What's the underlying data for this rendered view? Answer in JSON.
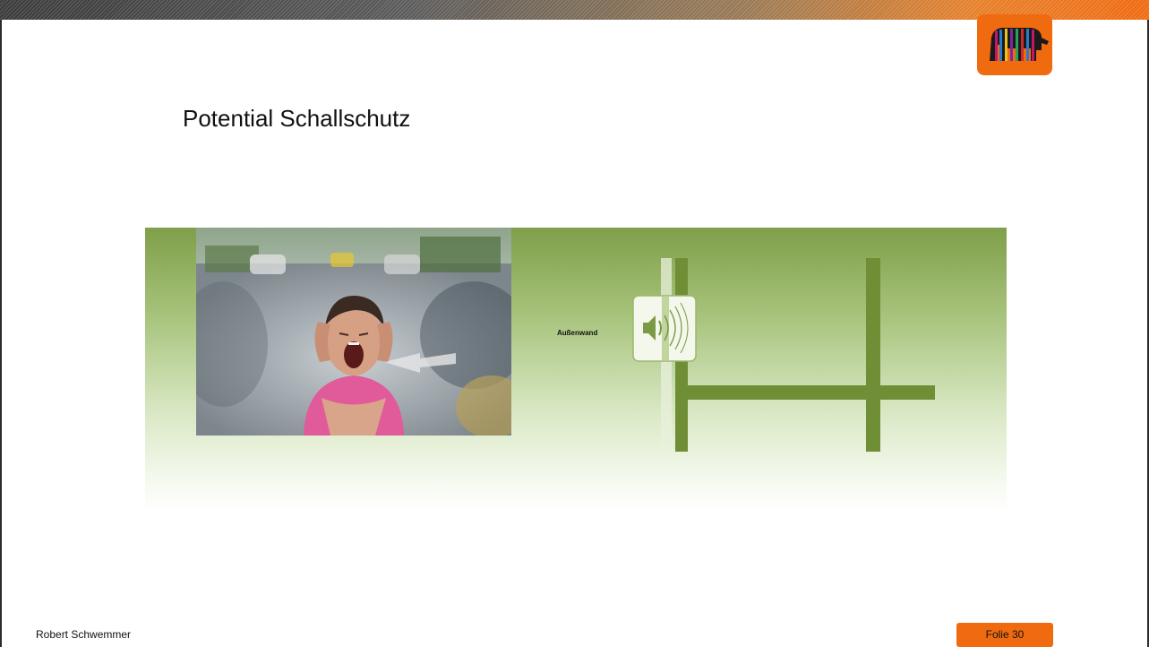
{
  "slide": {
    "title": "Potential Schallschutz",
    "wall_label": "Außenwand",
    "footer_author": "Robert Schwemmer",
    "slide_number": "Folie 30"
  },
  "colors": {
    "accent_orange": "#f06a10",
    "wall_green": "#6f8e36",
    "panel_green": "#7f9f4a"
  },
  "icons": {
    "logo": "elephant-logo",
    "sound": "speaker-sound-waves-icon"
  }
}
